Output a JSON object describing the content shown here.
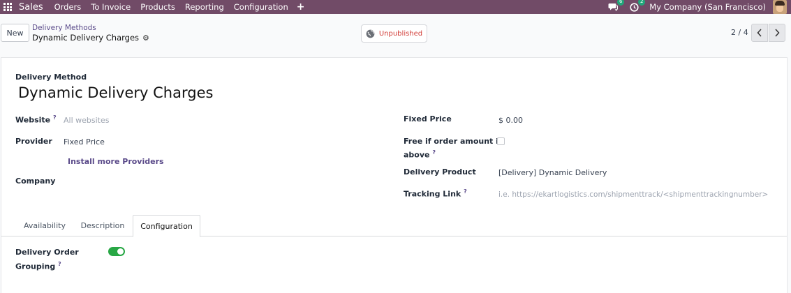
{
  "colors": {
    "brand": "#714b67",
    "accent": "#5b4b8a",
    "unpublished": "#d23f3a",
    "toggle_on": "#28a745",
    "badge": "#21a67a"
  },
  "navbar": {
    "app_name": "Sales",
    "menu": [
      "Orders",
      "To Invoice",
      "Products",
      "Reporting",
      "Configuration"
    ],
    "plus_icon": "+",
    "messages_icon": "chat-icon",
    "messages_count": "6",
    "activities_icon": "clock-icon",
    "activities_count": "2",
    "company": "My Company (San Francisco)"
  },
  "control": {
    "new_label": "New",
    "breadcrumb_parent": "Delivery Methods",
    "breadcrumb_current": "Dynamic Delivery Charges",
    "publish_status": "Unpublished",
    "pager": "2 / 4"
  },
  "form": {
    "record_type_label": "Delivery Method",
    "name": "Dynamic Delivery Charges",
    "website_label": "Website",
    "website_placeholder": "All websites",
    "provider_label": "Provider",
    "provider_value": "Fixed Price",
    "install_providers_link": "Install more Providers",
    "company_label": "Company",
    "company_value": "",
    "fixed_price_label": "Fixed Price",
    "fixed_price_value": "$ 0.00",
    "free_if_label_line1": "Free if order amount is",
    "free_if_label_line2": "above",
    "free_if_checked": false,
    "delivery_product_label": "Delivery Product",
    "delivery_product_value": "[Delivery] Dynamic Delivery",
    "tracking_link_label": "Tracking Link",
    "tracking_link_placeholder": "i.e. https://ekartlogistics.com/shipmenttrack/<shipmenttrackingnumber>",
    "help_mark": "?"
  },
  "tabs": [
    {
      "label": "Availability",
      "active": false
    },
    {
      "label": "Description",
      "active": false
    },
    {
      "label": "Configuration",
      "active": true
    }
  ],
  "configuration": {
    "grouping_label_line1": "Delivery Order",
    "grouping_label_line2": "Grouping",
    "grouping_enabled": true
  }
}
